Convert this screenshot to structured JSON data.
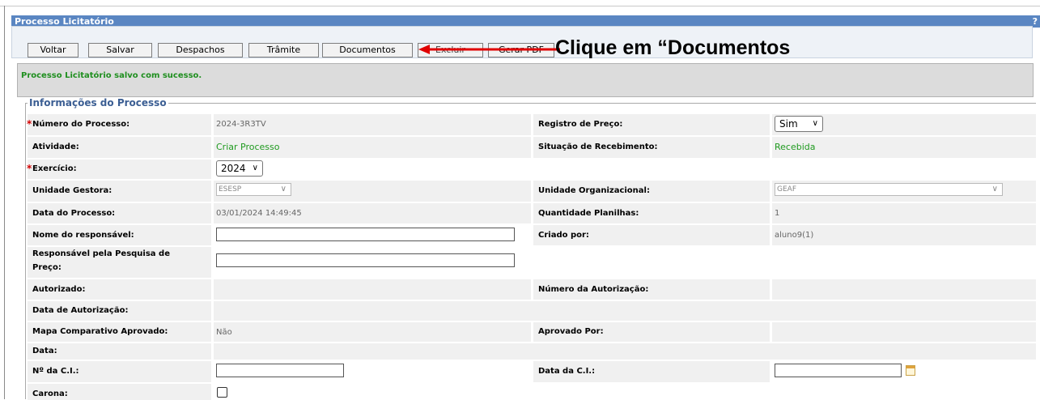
{
  "window": {
    "title": "Processo Licitatório",
    "help": "?"
  },
  "toolbar": {
    "voltar": "Voltar",
    "salvar": "Salvar",
    "despachos": "Despachos",
    "tramite": "Trâmite",
    "documentos": "Documentos",
    "excluir": "Excluir",
    "gerar_pdf": "Gerar PDF"
  },
  "callout": "Clique em “Documentos",
  "message": "Processo Licitatório salvo com sucesso.",
  "section": {
    "legend": "Informações do Processo"
  },
  "fields": {
    "numero_processo": {
      "label": "Número do Processo:",
      "value": "2024-3R3TV",
      "required": "*"
    },
    "registro_preco": {
      "label": "Registro de Preço:",
      "value": "Sim"
    },
    "atividade": {
      "label": "Atividade:",
      "value": "Criar Processo"
    },
    "situacao_recebimento": {
      "label": "Situação de Recebimento:",
      "value": "Recebida"
    },
    "exercicio": {
      "label": "Exercício:",
      "value": "2024",
      "required": "*"
    },
    "unidade_gestora": {
      "label": "Unidade Gestora:",
      "value": "ESESP"
    },
    "unidade_organizacional": {
      "label": "Unidade Organizacional:",
      "value": "GEAF"
    },
    "data_processo": {
      "label": "Data do Processo:",
      "value": "03/01/2024 14:49:45"
    },
    "quantidade_planilhas": {
      "label": "Quantidade Planilhas:",
      "value": "1"
    },
    "nome_responsavel": {
      "label": "Nome do responsável:",
      "value": ""
    },
    "criado_por": {
      "label": "Criado por:",
      "value": "aluno9(1)"
    },
    "responsavel_pesquisa": {
      "label_line1": "Responsável pela Pesquisa de",
      "label_line2": "Preço:",
      "value": ""
    },
    "autorizado": {
      "label": "Autorizado:",
      "value": ""
    },
    "numero_autorizacao": {
      "label": "Número da Autorização:",
      "value": ""
    },
    "data_autorizacao": {
      "label": "Data de Autorização:",
      "value": ""
    },
    "mapa_comparativo": {
      "label": "Mapa Comparativo Aprovado:",
      "value": "Não"
    },
    "aprovado_por": {
      "label": "Aprovado Por:",
      "value": ""
    },
    "data": {
      "label": "Data:",
      "value": ""
    },
    "numero_ci": {
      "label": "Nº da C.I.:",
      "value": ""
    },
    "data_ci": {
      "label": "Data da C.I.:",
      "value": ""
    },
    "carona": {
      "label": "Carona:",
      "checked": false
    }
  },
  "icons": {
    "calendar": "calendar-icon",
    "dropdown": "chevron-down-icon",
    "arrow": "red-arrow-left-icon"
  },
  "colors": {
    "titlebar": "#5a86c2",
    "success": "#1f8f1f",
    "required": "#d40000",
    "arrow": "#e00000",
    "legend": "#3b5e93"
  }
}
